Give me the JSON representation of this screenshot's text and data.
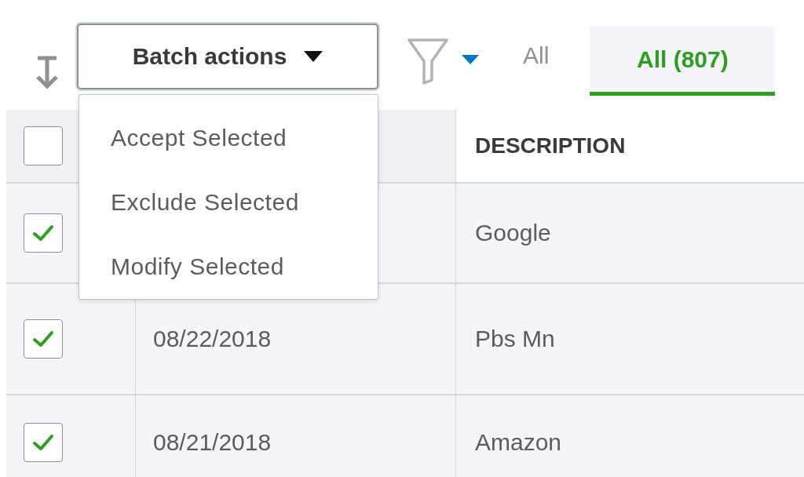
{
  "toolbar": {
    "batch_button": {
      "label": "Batch actions"
    },
    "batch_menu": {
      "expanded": true,
      "items": [
        "Accept Selected",
        "Exclude Selected",
        "Modify Selected"
      ]
    },
    "tabs": [
      {
        "label": "All",
        "selected": false
      },
      {
        "label": "All (807)",
        "selected": true
      }
    ]
  },
  "table": {
    "select_all": {
      "checked": false
    },
    "description_heading": "DESCRIPTION",
    "rows": [
      {
        "checked": true,
        "description": "Google"
      },
      {
        "checked": true,
        "date": "08/22/2018",
        "description": "Pbs Mn"
      },
      {
        "checked": true,
        "date": "08/21/2018",
        "description": "Amazon"
      }
    ]
  }
}
